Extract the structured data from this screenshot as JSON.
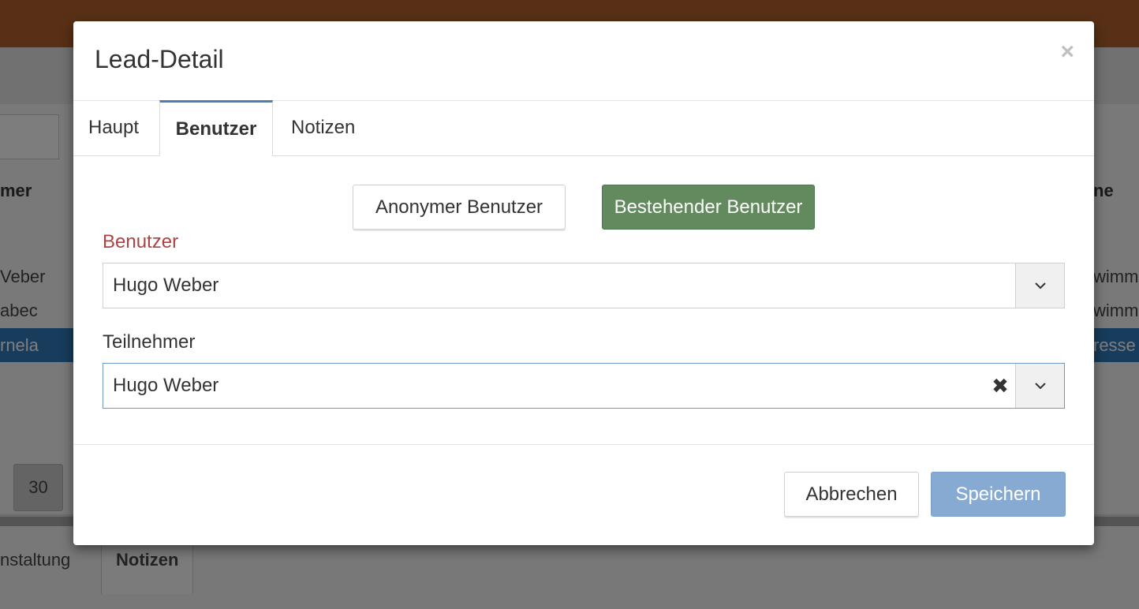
{
  "background": {
    "table_header_left": "mer",
    "table_header_right": "ne",
    "rows_left": [
      "Veber",
      "abec",
      "rnela"
    ],
    "rows_right": [
      "wimm",
      "wimm",
      "resse"
    ],
    "page_number": "30",
    "bottom_tabs": [
      "nstaltung",
      "Notizen"
    ]
  },
  "modal": {
    "title": "Lead-Detail",
    "close_icon": "×",
    "tabs": [
      {
        "label": "Haupt",
        "active": false
      },
      {
        "label": "Benutzer",
        "active": true
      },
      {
        "label": "Notizen",
        "active": false
      }
    ],
    "user_type": {
      "anonymous_label": "Anonymer Benutzer",
      "existing_label": "Bestehender Benutzer",
      "selected": "existing"
    },
    "benutzer": {
      "label": "Benutzer",
      "value": "Hugo Weber"
    },
    "teilnehmer": {
      "label": "Teilnehmer",
      "value": "Hugo Weber",
      "clear_icon": "✖"
    },
    "footer": {
      "cancel_label": "Abbrechen",
      "save_label": "Speichern"
    }
  },
  "colors": {
    "topbar": "#b0602a",
    "selected_row": "#2e79b9",
    "success": "#628a5e",
    "primary": "#87aad3",
    "error_label": "#a94442",
    "tab_accent": "#4a7fb0"
  }
}
